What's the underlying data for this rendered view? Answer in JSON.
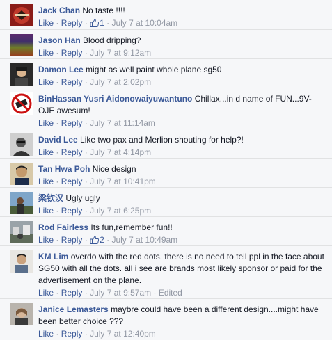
{
  "labels": {
    "like": "Like",
    "reply": "Reply",
    "sep": "·"
  },
  "comments": [
    {
      "author": "Jack Chan",
      "text": "No taste !!!!",
      "likes": "1",
      "time": "July 7 at 10:04am",
      "edited": ""
    },
    {
      "author": "Jason Han",
      "text": "Blood dripping?",
      "likes": "",
      "time": "July 7 at 9:12am",
      "edited": ""
    },
    {
      "author": "Damon Lee",
      "text": "might as well paint whole plane sg50",
      "likes": "",
      "time": "July 7 at 2:02pm",
      "edited": ""
    },
    {
      "author": "BinHassan Yusri Aidonowaiyuwantuno",
      "text": "Chillax...in d name of FUN...9V-OJE awesum!",
      "likes": "",
      "time": "July 7 at 11:14am",
      "edited": ""
    },
    {
      "author": "David Lee",
      "text": "Like two pax and Merlion shouting for help?!",
      "likes": "",
      "time": "July 7 at 4:14pm",
      "edited": ""
    },
    {
      "author": "Tan Hwa Poh",
      "text": "Nice design",
      "likes": "",
      "time": "July 7 at 10:41pm",
      "edited": ""
    },
    {
      "author": "梁钦汉",
      "text": "Ugly ugly",
      "likes": "",
      "time": "July 7 at 6:25pm",
      "edited": ""
    },
    {
      "author": "Rod Fairless",
      "text": "Its fun,remember fun!!",
      "likes": "2",
      "time": "July 7 at 10:49am",
      "edited": ""
    },
    {
      "author": "KM Lim",
      "text": "overdo with the red dots. there is no need to tell ppl in the face about SG50 with all the dots. all i see are brands most likely sponsor or paid for the advertisement on the plane.",
      "likes": "",
      "time": "July 7 at 9:57am",
      "edited": "Edited"
    },
    {
      "author": "Janice Lemasters",
      "text": "maybre could have been a different design....might have been better choice ???",
      "likes": "",
      "time": "July 7 at 12:40pm",
      "edited": ""
    }
  ]
}
